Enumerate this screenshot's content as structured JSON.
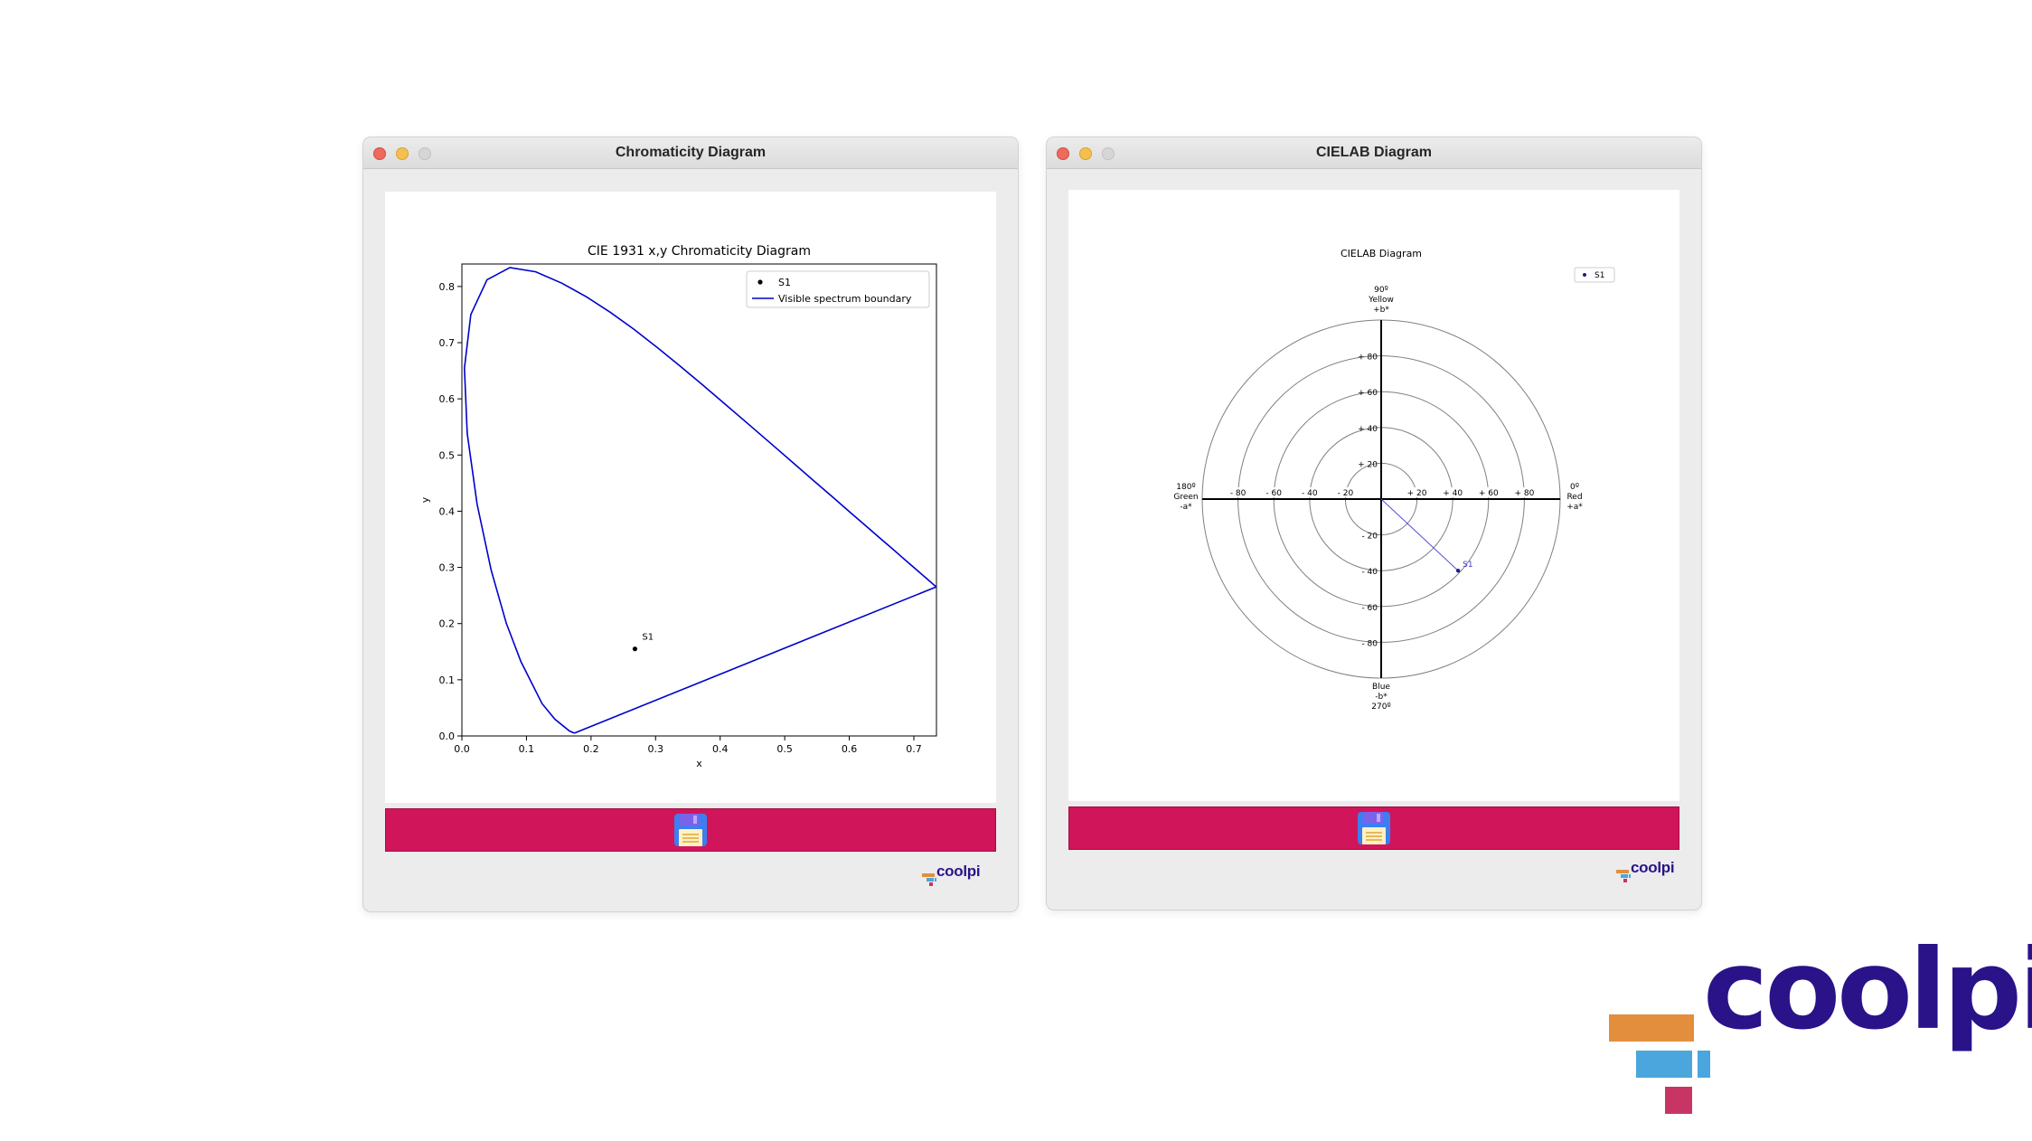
{
  "windows": [
    {
      "title": "Chromaticity Diagram",
      "save_icon": "floppy-disk-icon"
    },
    {
      "title": "CIELAB Diagram",
      "save_icon": "floppy-disk-icon"
    }
  ],
  "brand": {
    "name": "coolpi",
    "mini_name": "coolpi",
    "text_color": "#2a1289",
    "bar_colors": [
      "#e38e3c",
      "#4aa6dd",
      "#c83565"
    ]
  },
  "colors": {
    "save_bar": "#d1155b",
    "spectrum_line": "#0000cc"
  },
  "chart_data": [
    {
      "type": "line",
      "title": "CIE 1931 x,y Chromaticity Diagram",
      "xlabel": "x",
      "ylabel": "y",
      "xlim": [
        0.0,
        0.735
      ],
      "ylim": [
        0.0,
        0.84
      ],
      "xticks": [
        "0.0",
        "0.1",
        "0.2",
        "0.3",
        "0.4",
        "0.5",
        "0.6",
        "0.7"
      ],
      "yticks": [
        "0.0",
        "0.1",
        "0.2",
        "0.3",
        "0.4",
        "0.5",
        "0.6",
        "0.7",
        "0.8"
      ],
      "legend": {
        "position": "top-right",
        "entries": [
          "S1",
          "Visible spectrum boundary"
        ]
      },
      "series": [
        {
          "name": "Visible spectrum boundary",
          "x": [
            0.1741,
            0.1666,
            0.144,
            0.1241,
            0.0913,
            0.0687,
            0.0454,
            0.0235,
            0.0082,
            0.0039,
            0.0139,
            0.0389,
            0.0743,
            0.1142,
            0.1547,
            0.1929,
            0.2296,
            0.2658,
            0.3016,
            0.3373,
            0.3731,
            0.4087,
            0.4441,
            0.4788,
            0.5125,
            0.5448,
            0.5752,
            0.6029,
            0.627,
            0.6482,
            0.6658,
            0.6801,
            0.6915,
            0.7006,
            0.7079,
            0.714,
            0.719,
            0.723,
            0.726,
            0.7283,
            0.73,
            0.7347,
            0.1741
          ],
          "y": [
            0.005,
            0.0089,
            0.0297,
            0.0578,
            0.1327,
            0.2007,
            0.295,
            0.4127,
            0.5384,
            0.6548,
            0.7502,
            0.812,
            0.8338,
            0.8262,
            0.8059,
            0.7816,
            0.7543,
            0.7243,
            0.6923,
            0.6589,
            0.6245,
            0.5896,
            0.5547,
            0.5202,
            0.4866,
            0.4544,
            0.4242,
            0.3965,
            0.3725,
            0.3514,
            0.334,
            0.3197,
            0.3083,
            0.2993,
            0.292,
            0.2859,
            0.2809,
            0.277,
            0.274,
            0.2717,
            0.27,
            0.2653,
            0.005
          ]
        },
        {
          "name": "S1",
          "x": [
            0.268
          ],
          "y": [
            0.155
          ],
          "label": "S1"
        }
      ]
    },
    {
      "type": "scatter",
      "title": "CIELAB Diagram",
      "axis": "polar a*/b*",
      "range": [
        -100,
        100
      ],
      "rings": [
        20,
        40,
        60,
        80,
        100
      ],
      "a_ticks": [
        "- 80",
        "- 60",
        "- 40",
        "- 20",
        "+ 20",
        "+ 40",
        "+ 60",
        "+ 80"
      ],
      "b_ticks_pos": [
        "+ 20",
        "+ 40",
        "+ 60",
        "+ 80"
      ],
      "b_ticks_neg": [
        "- 20",
        "- 40",
        "- 60",
        "- 80"
      ],
      "directions": {
        "top": [
          "90º",
          "Yellow",
          "+b*"
        ],
        "bottom": [
          "Blue",
          "-b*",
          "270º"
        ],
        "left": [
          "180º",
          "Green",
          "-a*"
        ],
        "right": [
          "0º",
          "Red",
          "+a*"
        ]
      },
      "legend": {
        "position": "top-right",
        "entries": [
          "S1"
        ]
      },
      "series": [
        {
          "name": "S1",
          "a": 43,
          "b": -40,
          "label": "S1"
        }
      ]
    }
  ]
}
